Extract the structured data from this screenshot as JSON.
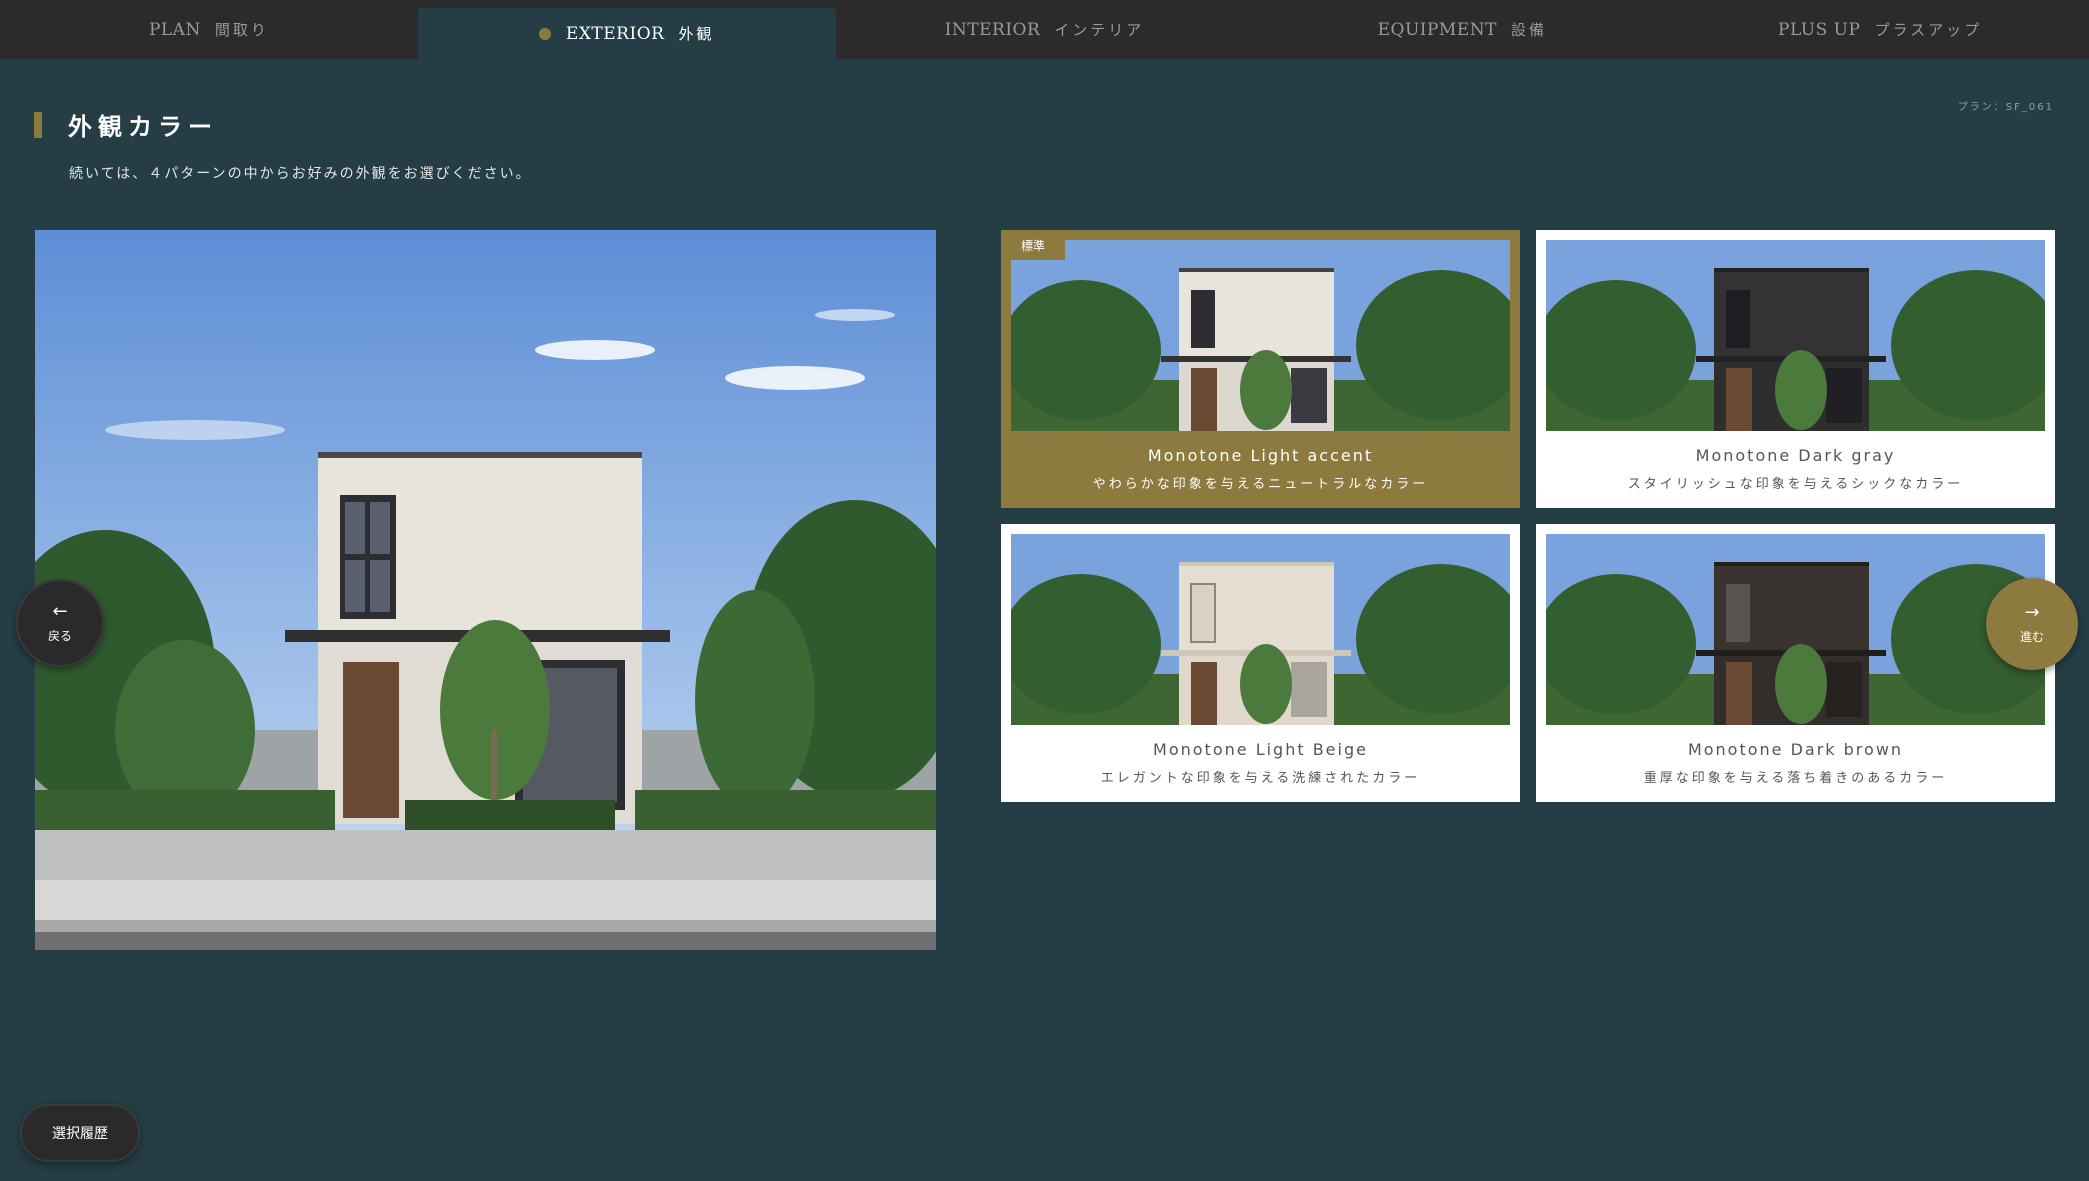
{
  "nav": {
    "tabs": [
      {
        "en": "PLAN",
        "jp": "間取り"
      },
      {
        "en": "EXTERIOR",
        "jp": "外観"
      },
      {
        "en": "INTERIOR",
        "jp": "インテリア"
      },
      {
        "en": "EQUIPMENT",
        "jp": "設備"
      },
      {
        "en": "PLUS UP",
        "jp": "プラスアップ"
      }
    ],
    "active_index": 1
  },
  "page": {
    "title": "外観カラー",
    "subtitle": "続いては、４パターンの中からお好みの外観をお選びください。",
    "plan_code": "プラン：SF_061"
  },
  "options": [
    {
      "name": "Monotone Light accent",
      "desc": "やわらかな印象を与えるニュートラルなカラー",
      "badge": "標準"
    },
    {
      "name": "Monotone Dark gray",
      "desc": "スタイリッシュな印象を与えるシックなカラー"
    },
    {
      "name": "Monotone Light Beige",
      "desc": "エレガントな印象を与える洗練されたカラー"
    },
    {
      "name": "Monotone Dark brown",
      "desc": "重厚な印象を与える落ち着きのあるカラー"
    }
  ],
  "controls": {
    "back_arrow": "←",
    "back_label": "戻る",
    "next_arrow": "→",
    "next_label": "進む",
    "history_label": "選択履歴"
  },
  "colors": {
    "accent": "#8c7a3e",
    "background": "#253d45",
    "nav_bg": "#2b2b2b",
    "wall_light": "#e8e4dc",
    "wall_dark": "#333333",
    "wall_beige": "#e4ddd1",
    "wall_brown": "#3a3431"
  }
}
